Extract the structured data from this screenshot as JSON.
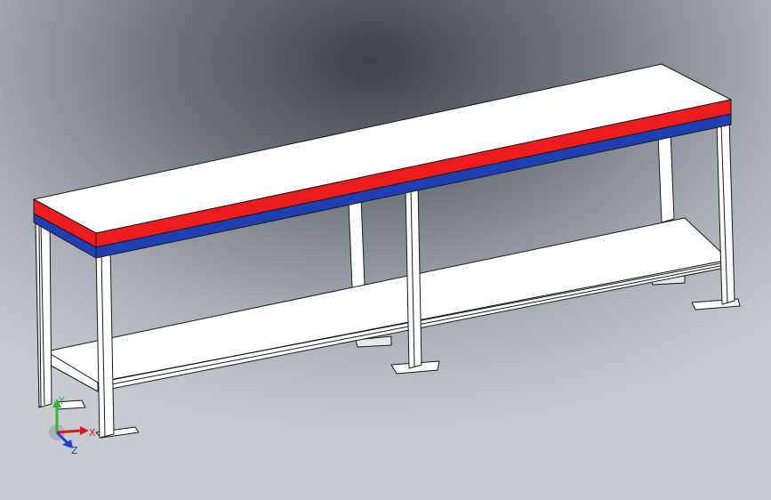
{
  "viewport": {
    "background_top": "#4a4d55",
    "background_mid": "#8e939c",
    "background_bottom": "#c9ccd3"
  },
  "model": {
    "name": "workbench",
    "colors": {
      "white": "#ffffff",
      "edge": "#1a1a1a",
      "red_band": "#ee1c1c",
      "blue_band": "#1f3fb4",
      "shadow": "#b9bcc2"
    }
  },
  "triad": {
    "x_label": "X",
    "y_label": "Y",
    "z_label": "Z",
    "x_color": "#d81b1b",
    "y_color": "#2fb82f",
    "z_color": "#1f3fd0"
  }
}
